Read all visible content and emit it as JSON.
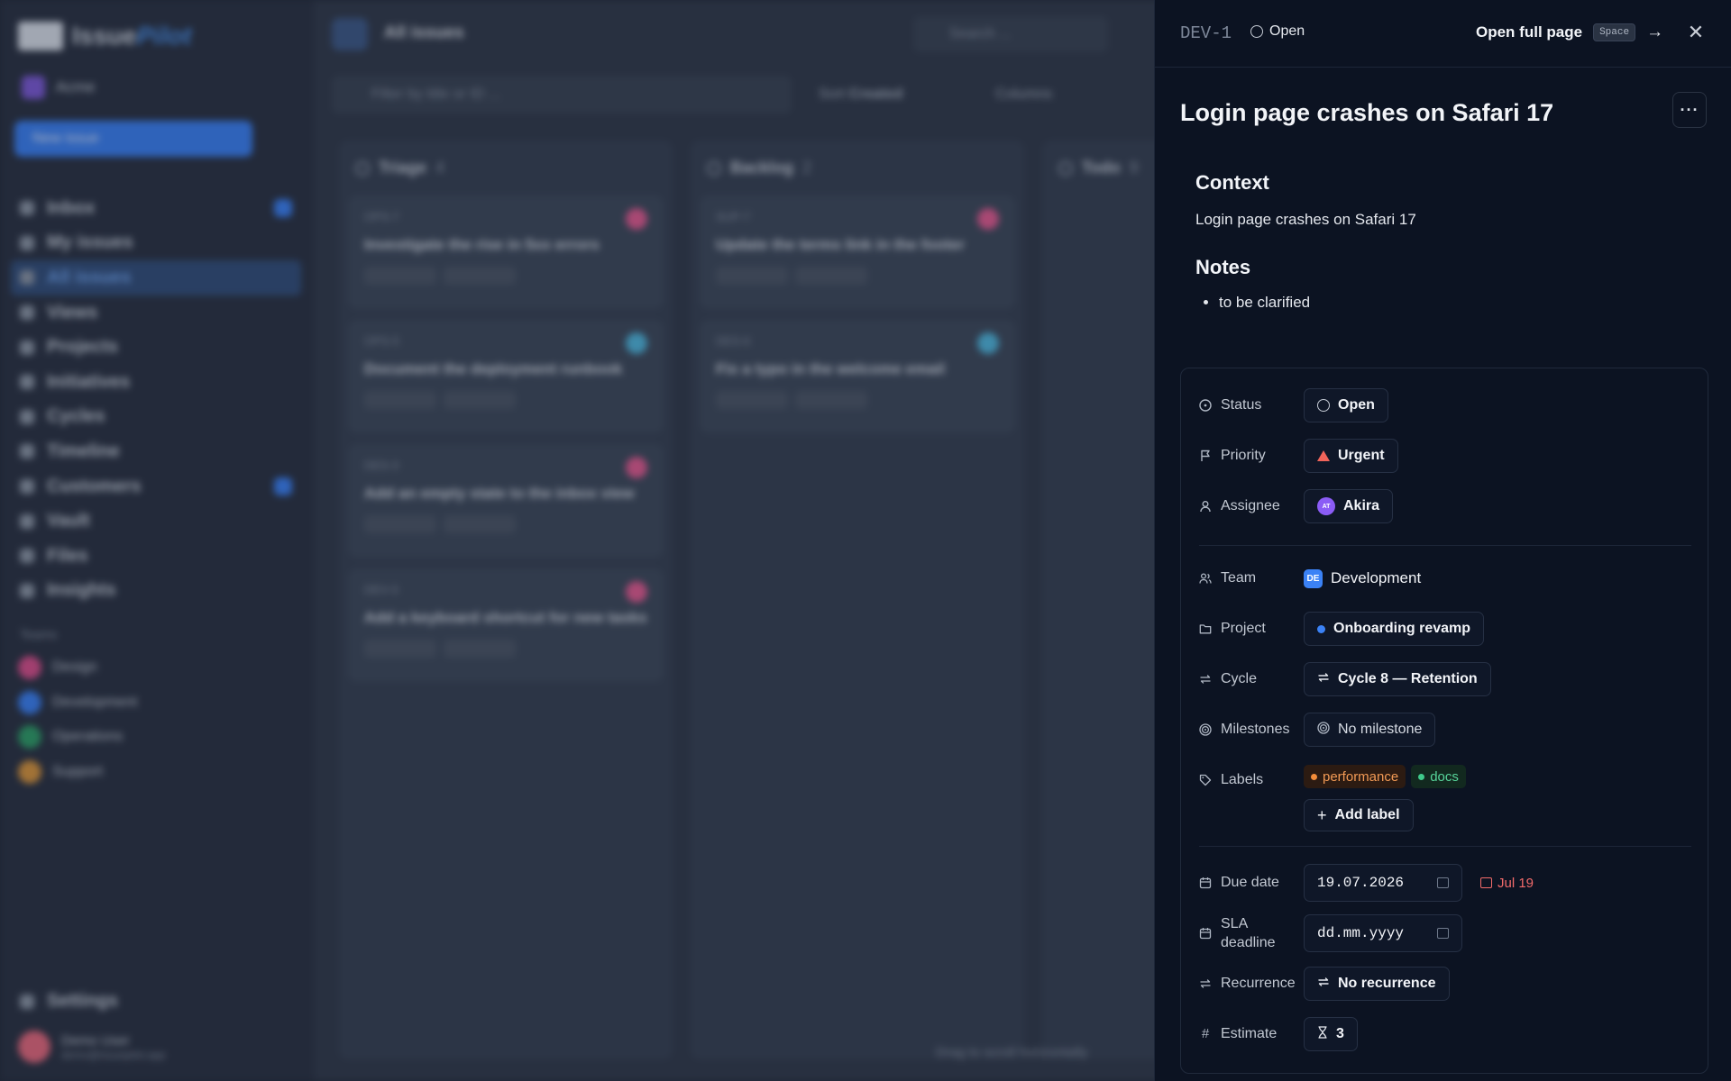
{
  "background": {
    "brand": {
      "name_a": "Issue",
      "name_b": "Pilot"
    },
    "workspace": "Acme",
    "new_issue_label": "New issue",
    "nav": [
      "Inbox",
      "My issues",
      "All issues",
      "Views",
      "Projects",
      "Initiatives",
      "Cycles",
      "Timeline",
      "Customers",
      "Vault",
      "Files",
      "Insights"
    ],
    "teams_heading": "Teams",
    "teams": [
      "Design",
      "Development",
      "Operations",
      "Support"
    ],
    "settings_label": "Settings",
    "user": {
      "name": "Demo User",
      "email": "demo@issuepilot.app"
    },
    "page_title": "All issues",
    "search_placeholder": "Search ...",
    "filter_placeholder": "Filter by title or ID ...",
    "sort_label": "Sort",
    "sort_value": "Created",
    "columns_label": "Columns",
    "drag_hint": "Drag to scroll horizontally",
    "board": [
      {
        "name": "Triage",
        "count": "4",
        "cards": [
          {
            "id": "OPS-7",
            "title": "Investigate the rise in 5xx errors",
            "color": "#e25c94"
          },
          {
            "id": "OPS-5",
            "title": "Document the deployment runbook",
            "color": "#4fb8e0"
          },
          {
            "id": "DES-3",
            "title": "Add an empty state to the inbox view",
            "color": "#e25c94"
          },
          {
            "id": "DEV-3",
            "title": "Add a keyboard shortcut for new tasks",
            "color": "#e25c94"
          }
        ]
      },
      {
        "name": "Backlog",
        "count": "2",
        "cards": [
          {
            "id": "SUP-7",
            "title": "Update the terms link in the footer",
            "color": "#e25c94"
          },
          {
            "id": "DES-6",
            "title": "Fix a typo in the welcome email",
            "color": "#4fb8e0"
          }
        ]
      },
      {
        "name": "Todo",
        "count": "9",
        "cards": []
      }
    ]
  },
  "panel": {
    "issue_id": "DEV-1",
    "status": "Open",
    "open_full_page": "Open full page",
    "shortcut": "Space",
    "title": "Login page crashes on Safari 17",
    "description": {
      "context_heading": "Context",
      "context_text": "Login page crashes on Safari 17",
      "notes_heading": "Notes",
      "notes": [
        "to be clarified"
      ]
    },
    "properties": {
      "status": {
        "label": "Status",
        "value": "Open"
      },
      "priority": {
        "label": "Priority",
        "value": "Urgent",
        "color": "#f0645a"
      },
      "assignee": {
        "label": "Assignee",
        "value": "Akira",
        "initials": "AT",
        "color": "#8b5cf6"
      },
      "team": {
        "label": "Team",
        "value": "Development",
        "badge": "DE",
        "color": "#3b82f6"
      },
      "project": {
        "label": "Project",
        "value": "Onboarding revamp",
        "color": "#3b82f6"
      },
      "cycle": {
        "label": "Cycle",
        "value": "Cycle 8 — Retention"
      },
      "milestones": {
        "label": "Milestones",
        "value": "No milestone"
      },
      "labels": {
        "label": "Labels",
        "items": [
          {
            "name": "performance",
            "color": "#f28c3a"
          },
          {
            "name": "docs",
            "color": "#3fc98a"
          }
        ],
        "add_label": "Add label"
      },
      "due_date": {
        "label": "Due date",
        "value": "19.07.2026",
        "hint": "Jul 19"
      },
      "sla_deadline": {
        "label": "SLA deadline",
        "placeholder": "dd.mm.yyyy"
      },
      "recurrence": {
        "label": "Recurrence",
        "value": "No recurrence"
      },
      "estimate": {
        "label": "Estimate",
        "value": "3"
      }
    }
  }
}
